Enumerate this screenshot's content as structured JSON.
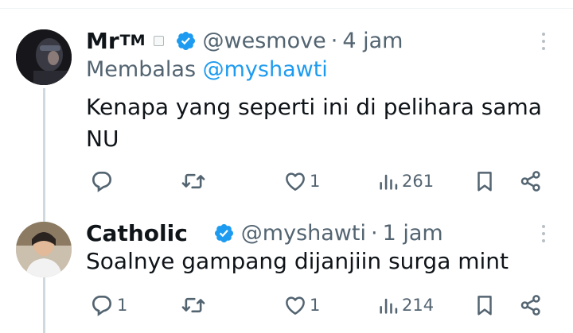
{
  "tweets": [
    {
      "display_name": "Mr",
      "name_suffix": "TM",
      "handle": "@wesmove",
      "separator": "·",
      "time": "4 jam",
      "reply_prefix": "Membalas",
      "reply_mention": "@myshawti",
      "text": "Kenapa yang seperti ini di pelihara sama NU",
      "actions": {
        "reply_count": "",
        "retweet_count": "",
        "like_count": "1",
        "views_count": "261"
      }
    },
    {
      "display_name": "Catholic",
      "handle": "@myshawti",
      "separator": "·",
      "time": "1 jam",
      "text": "Soalnye gampang dijanjiin surga mint",
      "actions": {
        "reply_count": "1",
        "retweet_count": "",
        "like_count": "1",
        "views_count": "214"
      }
    }
  ],
  "icons": [
    "verified-badge-icon",
    "reply-icon",
    "retweet-icon",
    "like-icon",
    "views-icon",
    "bookmark-icon",
    "share-icon",
    "more-icon"
  ],
  "colors": {
    "accent": "#1d9bf0",
    "text": "#0f1419",
    "muted": "#536471",
    "divider": "#eff3f4"
  }
}
